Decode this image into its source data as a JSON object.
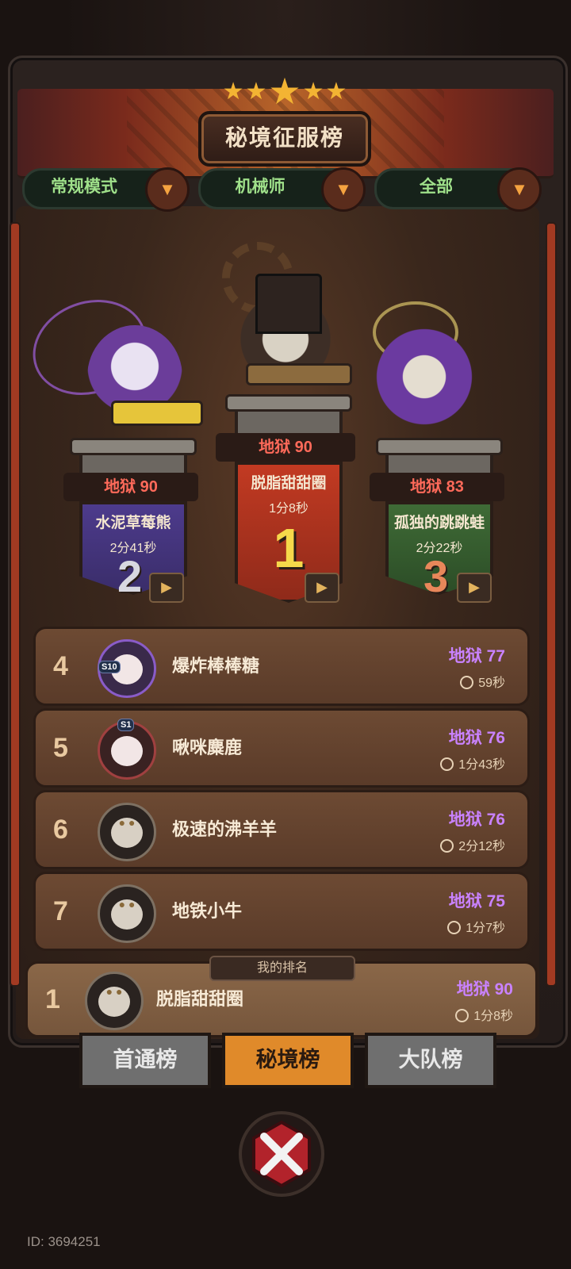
{
  "header": {
    "title": "秘境征服榜",
    "stars": "★★★★★"
  },
  "filters": [
    {
      "label": "常规模式"
    },
    {
      "label": "机械师"
    },
    {
      "label": "全部"
    }
  ],
  "podium": [
    {
      "rank": "2",
      "level": "地狱 90",
      "name": "水泥草莓熊",
      "time": "2分41秒"
    },
    {
      "rank": "1",
      "level": "地狱 90",
      "name": "脱脂甜甜圈",
      "time": "1分8秒"
    },
    {
      "rank": "3",
      "level": "地狱 83",
      "name": "孤独的跳跳蛙",
      "time": "2分22秒"
    }
  ],
  "list": [
    {
      "rank": "4",
      "name": "爆炸棒棒糖",
      "level": "地狱 77",
      "time": "59秒",
      "season": "S10"
    },
    {
      "rank": "5",
      "name": "啾咪麋鹿",
      "level": "地狱 76",
      "time": "1分43秒",
      "season": "S1"
    },
    {
      "rank": "6",
      "name": "极速的沸羊羊",
      "level": "地狱 76",
      "time": "2分12秒"
    },
    {
      "rank": "7",
      "name": "地铁小牛",
      "level": "地狱 75",
      "time": "1分7秒"
    }
  ],
  "my_rank": {
    "tag": "我的排名",
    "rank": "1",
    "name": "脱脂甜甜圈",
    "level": "地狱 90",
    "time": "1分8秒"
  },
  "tabs": [
    {
      "label": "首通榜",
      "active": false
    },
    {
      "label": "秘境榜",
      "active": true
    },
    {
      "label": "大队榜",
      "active": false
    }
  ],
  "footer": {
    "id_text": "ID: 3694251"
  },
  "colors": {
    "accent_orange": "#e08a2a",
    "hell_red": "#ff6a5a",
    "hell_purple": "#c982ff",
    "filter_green": "#9fe08a"
  },
  "icons": {
    "dropdown": "chevron-down-icon",
    "video": "video-camera-icon",
    "clock": "clock-icon",
    "close": "close-emblem-icon"
  }
}
